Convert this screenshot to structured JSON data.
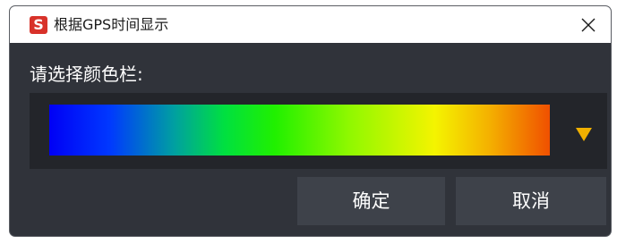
{
  "window": {
    "title": "根据GPS时间显示",
    "app_icon_letter": "S",
    "app_icon_color": "#d8322a",
    "close_icon": "close-icon"
  },
  "dialog": {
    "prompt": "请选择颜色栏:",
    "colorbar": {
      "selected": "blue-cyan-green-yellow-orange",
      "stops": [
        "#0000f5",
        "#0078ff",
        "#00e070",
        "#18f010",
        "#80f800",
        "#f4f400",
        "#f4b400",
        "#f07000",
        "#f05000"
      ],
      "dropdown_icon": "triangle-down-icon",
      "accent": "#f0b000"
    },
    "buttons": {
      "ok_label": "确定",
      "cancel_label": "取消"
    }
  }
}
